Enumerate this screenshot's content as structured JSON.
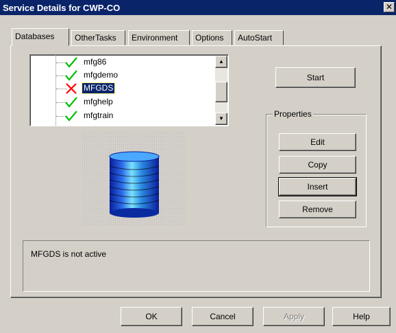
{
  "window": {
    "title": "Service Details for CWP-CO",
    "close_glyph": "✕"
  },
  "tabs": [
    {
      "label": "Databases",
      "active": true
    },
    {
      "label": "OtherTasks",
      "active": false
    },
    {
      "label": "Environment",
      "active": false
    },
    {
      "label": "Options",
      "active": false
    },
    {
      "label": "AutoStart",
      "active": false
    }
  ],
  "database_list": {
    "items": [
      {
        "label": "mfg86",
        "status": "active"
      },
      {
        "label": "mfgdemo",
        "status": "active"
      },
      {
        "label": "MFGDS",
        "status": "inactive",
        "selected": true
      },
      {
        "label": "mfghelp",
        "status": "active"
      },
      {
        "label": "mfgtrain",
        "status": "active"
      }
    ]
  },
  "start_button": {
    "label": "Start"
  },
  "properties": {
    "label": "Properties",
    "buttons": {
      "edit": "Edit",
      "copy": "Copy",
      "insert": "Insert",
      "remove": "Remove"
    }
  },
  "status_message": "MFGDS is not active",
  "footer": {
    "ok": "OK",
    "cancel": "Cancel",
    "apply": "Apply",
    "help": "Help"
  },
  "colors": {
    "titlebar": "#0a246a",
    "active_check": "#00c000",
    "inactive_x": "#ff0000",
    "database_fill": "#1e5adc"
  }
}
